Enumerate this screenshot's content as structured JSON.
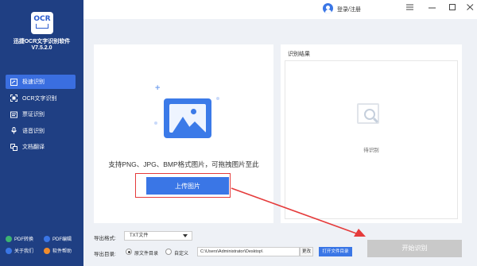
{
  "sidebar": {
    "logo_text": "OCR",
    "app_title": "迅捷OCR文字识别软件",
    "version": "V7.5.2.0",
    "items": [
      {
        "label": "极速识别",
        "icon": "quick-scan-icon"
      },
      {
        "label": "OCR文字识别",
        "icon": "scan-frame-icon"
      },
      {
        "label": "票证识别",
        "icon": "ticket-icon"
      },
      {
        "label": "语音识别",
        "icon": "microphone-icon"
      },
      {
        "label": "文档翻译",
        "icon": "translate-icon"
      }
    ],
    "bottom_links": [
      {
        "label": "PDF转换",
        "icon": "pdf-convert-icon",
        "color": "#3cb371"
      },
      {
        "label": "PDF编辑",
        "icon": "pdf-edit-icon",
        "color": "#3a76e6"
      },
      {
        "label": "关于我们",
        "icon": "about-icon",
        "color": "#3a76e6"
      },
      {
        "label": "软件帮助",
        "icon": "help-icon",
        "color": "#f08c2c"
      }
    ]
  },
  "topbar": {
    "login_label": "登录/注册"
  },
  "upload": {
    "support_text": "支持PNG、JPG、BMP格式图片，可拖拽图片至此",
    "button_label": "上传图片"
  },
  "result": {
    "title": "识别结果",
    "waiting_text": "待识别"
  },
  "output": {
    "format_label": "导出格式:",
    "format_value": "TXT文件",
    "dir_label": "导出目录:",
    "radio_source": "原文件目录",
    "radio_custom": "自定义",
    "path_value": "C:\\Users\\Administrator\\Desktop\\",
    "change_label": "更改",
    "open_dir_label": "打开文件目录",
    "start_label": "开始识别"
  },
  "colors": {
    "sidebar_bg": "#1f3f83",
    "accent": "#3a76e6",
    "annotation_red": "#e53b3b"
  }
}
